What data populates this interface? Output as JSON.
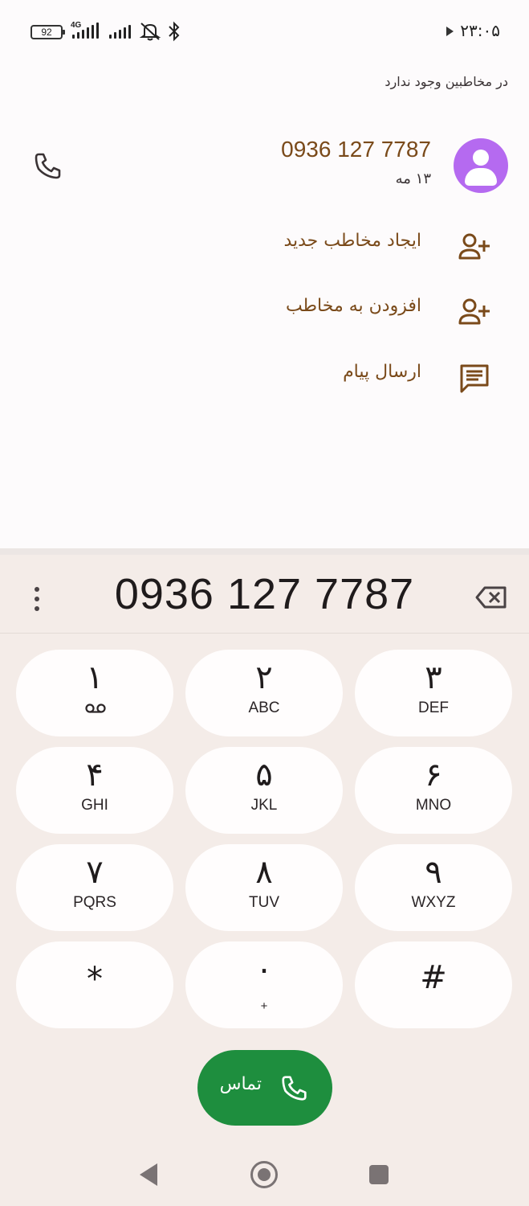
{
  "status_bar": {
    "battery": "92",
    "network": "4G",
    "time": "۲۳:۰۵"
  },
  "header": {
    "no_contact_text": "در مخاطبین وجود ندارد"
  },
  "contact": {
    "number": "0936 127 7787",
    "date": "۱۳ مه"
  },
  "actions": [
    {
      "label": "ایجاد مخاطب جدید",
      "icon": "add-person-icon"
    },
    {
      "label": "افزودن به مخاطب",
      "icon": "add-person-icon"
    },
    {
      "label": "ارسال پیام",
      "icon": "message-icon"
    }
  ],
  "dialer": {
    "display_number": "0936 127 7787",
    "keys": [
      {
        "digit": "۱",
        "letters": ""
      },
      {
        "digit": "۲",
        "letters": "ABC"
      },
      {
        "digit": "۳",
        "letters": "DEF"
      },
      {
        "digit": "۴",
        "letters": "GHI"
      },
      {
        "digit": "۵",
        "letters": "JKL"
      },
      {
        "digit": "۶",
        "letters": "MNO"
      },
      {
        "digit": "۷",
        "letters": "PQRS"
      },
      {
        "digit": "۸",
        "letters": "TUV"
      },
      {
        "digit": "۹",
        "letters": "WXYZ"
      },
      {
        "digit": "*",
        "letters": ""
      },
      {
        "digit": "۰",
        "letters": "+"
      },
      {
        "digit": "#",
        "letters": ""
      }
    ],
    "call_label": "تماس"
  },
  "colors": {
    "accent_brown": "#7a4a1a",
    "avatar_purple": "#b56af0",
    "call_green": "#1e8e3e",
    "dialer_bg": "#f4ece8"
  }
}
